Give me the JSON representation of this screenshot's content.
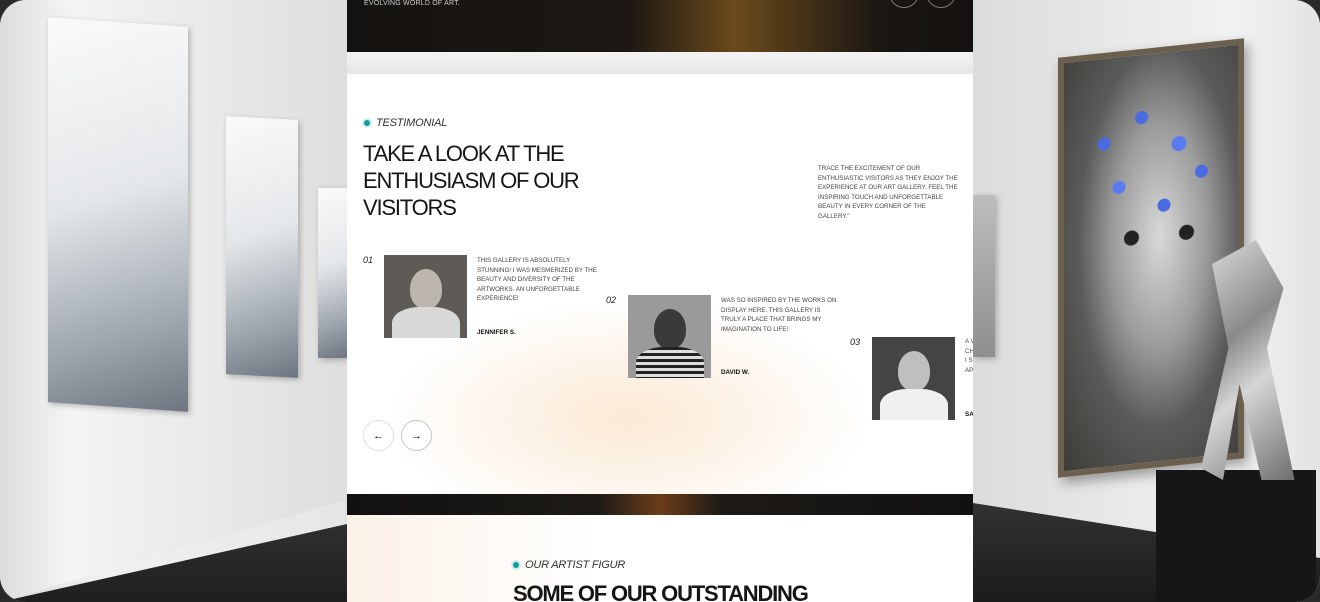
{
  "hero": {
    "tagline": "EVOLVING WORLD OF ART."
  },
  "testimonial": {
    "eyebrow": "TESTIMONIAL",
    "headline_line1": "TAKE A LOOK AT THE",
    "headline_line2": "ENTHUSIASM OF OUR",
    "headline_line3": "VISITORS",
    "intro": "TRACE THE EXCITEMENT OF OUR ENTHUSIASTIC VISITORS AS THEY ENJOY THE EXPERIENCE AT OUR ART GALLERY. FEEL THE INSPIRING TOUCH AND UNFORGETTABLE BEAUTY IN EVERY CORNER OF THE GALLERY.\"",
    "cards": [
      {
        "number": "01",
        "quote": "THIS GALLERY IS ABSOLUTELY STUNNING! I WAS MESMERIZED BY THE BEAUTY AND DIVERSITY OF THE ARTWORKS. AN UNFORGETTABLE EXPERIENCE!",
        "author": "JENNIFER S."
      },
      {
        "number": "02",
        "quote": "WAS SO INSPIRED BY THE WORKS ON DISPLAY HERE. THIS GALLERY IS TRULY A PLACE THAT BRINGS MY IMAGINATION TO LIFE!",
        "author": "DAVID W."
      },
      {
        "number": "03",
        "quote": "A V CH I S AP",
        "author": "SA"
      }
    ],
    "prev_icon": "arrow-left-icon",
    "next_icon": "arrow-right-icon",
    "prev_glyph": "←",
    "next_glyph": "→",
    "accent_color": "#1a9b98"
  },
  "artists": {
    "eyebrow": "OUR ARTIST FIGUR",
    "headline": "SOME OF OUR OUTSTANDING"
  }
}
